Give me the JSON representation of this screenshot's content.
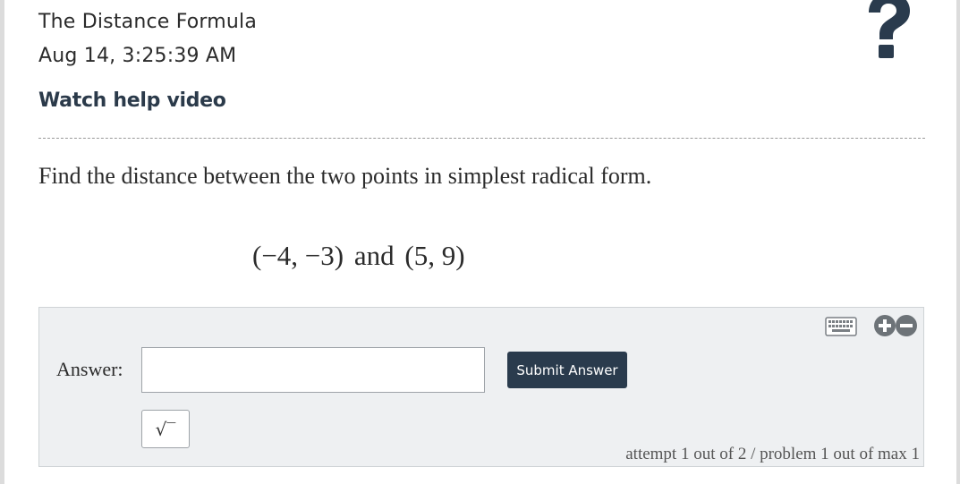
{
  "header": {
    "title": "The Distance Formula",
    "timestamp": "Aug 14, 3:25:39 AM",
    "help_link": "Watch help video",
    "help_icon": "question-mark-icon"
  },
  "question": {
    "prompt": "Find the distance between the two points in simplest radical form.",
    "point_a": "(−4, −3)",
    "conjunction": "and",
    "point_b": "(5, 9)"
  },
  "answer_panel": {
    "label": "Answer:",
    "input_value": "",
    "submit_label": "Submit Answer",
    "sqrt_button_label": "√‾",
    "attempt_text": "attempt 1 out of 2 / problem 1 out of max 1",
    "icons": [
      "keyboard-icon",
      "plus-icon",
      "minus-icon"
    ]
  },
  "colors": {
    "dark_navy": "#2a3b4d",
    "panel_bg": "#eef0f2"
  }
}
